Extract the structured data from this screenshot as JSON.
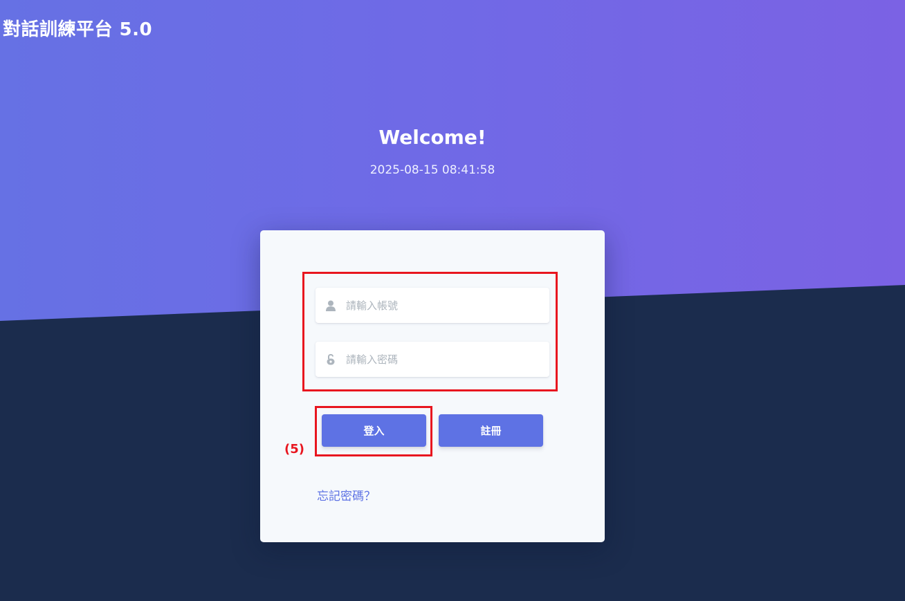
{
  "brand": {
    "title": "對話訓練平台 5.0"
  },
  "hero": {
    "welcome": "Welcome!",
    "datetime": "2025-08-15 08:41:58"
  },
  "login_form": {
    "username": {
      "placeholder": "請輸入帳號",
      "value": "",
      "icon": "user-icon"
    },
    "password": {
      "placeholder": "請輸入密碼",
      "value": "",
      "icon": "lock-open-icon"
    },
    "login_label": "登入",
    "register_label": "註冊",
    "forgot_label": "忘記密碼？"
  },
  "annotations": {
    "step_label": "(5)"
  },
  "colors": {
    "hero_gradient_start": "#6671e4",
    "hero_gradient_end": "#7b62e4",
    "page_background": "#1b2c4d",
    "primary": "#5e72e4",
    "annotation_red": "#e8161f"
  }
}
